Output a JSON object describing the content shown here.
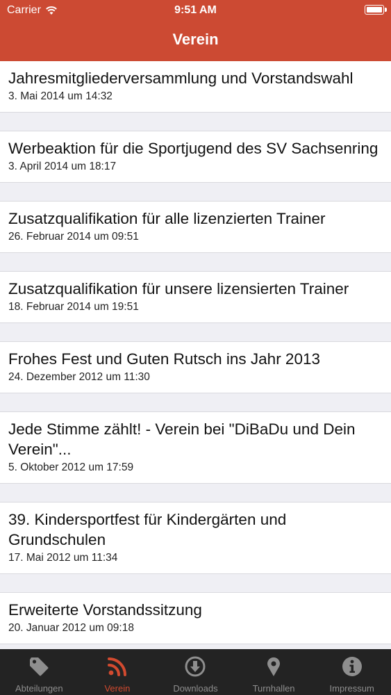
{
  "status_bar": {
    "carrier": "Carrier",
    "time": "9:51 AM"
  },
  "navigation": {
    "title": "Verein"
  },
  "news": [
    {
      "title": "Jahresmitgliederversammlung und Vorstandswahl",
      "date": "3. Mai 2014 um 14:32"
    },
    {
      "title": "Werbeaktion für die Sportjugend des SV Sachsenring",
      "date": "3. April 2014 um 18:17"
    },
    {
      "title": "Zusatzqualifikation für alle lizenzierten Trainer",
      "date": "26. Februar 2014 um 09:51"
    },
    {
      "title": "Zusatzqualifikation für unsere lizensierten Trainer",
      "date": "18. Februar 2014 um 19:51"
    },
    {
      "title": "Frohes Fest und Guten Rutsch ins Jahr 2013",
      "date": "24. Dezember 2012 um 11:30"
    },
    {
      "title": "Jede Stimme zählt! - Verein bei \"DiBaDu und Dein Verein\"...",
      "date": "5. Oktober 2012 um 17:59"
    },
    {
      "title": "39. Kindersportfest für Kindergärten und Grundschulen",
      "date": "17. Mai 2012 um 11:34"
    },
    {
      "title": "Erweiterte Vorstandssitzung",
      "date": "20. Januar 2012 um 09:18"
    }
  ],
  "tabbar": {
    "tabs": [
      {
        "label": "Abteilungen",
        "icon": "tag-icon",
        "active": false
      },
      {
        "label": "Verein",
        "icon": "rss-icon",
        "active": true
      },
      {
        "label": "Downloads",
        "icon": "download-icon",
        "active": false
      },
      {
        "label": "Turnhallen",
        "icon": "location-pin-icon",
        "active": false
      },
      {
        "label": "Impressum",
        "icon": "info-icon",
        "active": false
      }
    ]
  },
  "colors": {
    "accent": "#cc4a33",
    "tabbar_bg": "#232323",
    "tab_inactive": "#8e8e8e",
    "tab_active": "#d24a2f"
  }
}
